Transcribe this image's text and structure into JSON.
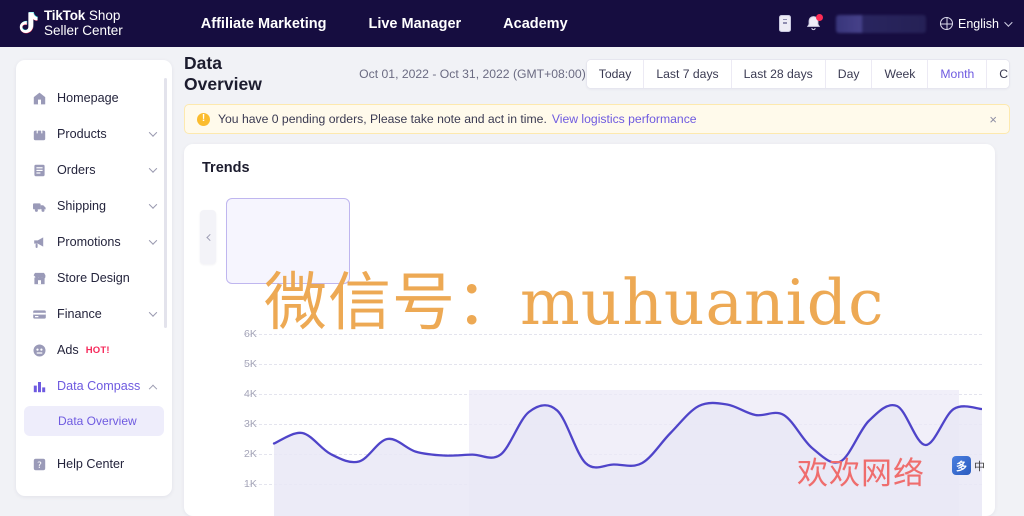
{
  "header": {
    "logo": {
      "brand": "TikTok",
      "brand_suffix": "Shop",
      "line2": "Seller Center",
      "icon": "tiktok-note-icon"
    },
    "nav": [
      {
        "label": "Affiliate Marketing"
      },
      {
        "label": "Live Manager"
      },
      {
        "label": "Academy"
      }
    ],
    "phone_icon": "mobile-phone-icon",
    "bell_icon": "notification-bell-icon",
    "language": {
      "label": "English",
      "icon": "globe-icon",
      "caret": "chevron-down-icon"
    }
  },
  "sidebar": {
    "items": [
      {
        "label": "Homepage",
        "icon": "home-icon",
        "expandable": false,
        "active": false
      },
      {
        "label": "Products",
        "icon": "bag-icon",
        "expandable": true,
        "active": false
      },
      {
        "label": "Orders",
        "icon": "receipt-icon",
        "expandable": true,
        "active": false
      },
      {
        "label": "Shipping",
        "icon": "truck-icon",
        "expandable": true,
        "active": false
      },
      {
        "label": "Promotions",
        "icon": "megaphone-icon",
        "expandable": true,
        "active": false
      },
      {
        "label": "Store Design",
        "icon": "storefront-icon",
        "expandable": false,
        "active": false
      },
      {
        "label": "Finance",
        "icon": "card-icon",
        "expandable": true,
        "active": false
      },
      {
        "label": "Ads",
        "icon": "ads-icon",
        "expandable": false,
        "active": false,
        "badge": "HOT!"
      },
      {
        "label": "Data Compass",
        "icon": "bar-chart-icon",
        "expandable": true,
        "expanded": true,
        "active": true
      }
    ],
    "sub_item": {
      "label": "Data Overview",
      "active": true
    },
    "last_item": {
      "label": "Help Center",
      "icon": "help-icon"
    },
    "accent": "#6e5ae0",
    "badge_color": "#f6285a"
  },
  "main": {
    "page_title": "Data Overview",
    "date_range": "Oct 01, 2022 - Oct 31, 2022 (GMT+08:00)",
    "range_tabs": [
      {
        "label": "Today",
        "active": false
      },
      {
        "label": "Last 7 days",
        "active": false
      },
      {
        "label": "Last 28 days",
        "active": false
      },
      {
        "label": "Day",
        "active": false
      },
      {
        "label": "Week",
        "active": false
      },
      {
        "label": "Month",
        "active": true
      },
      {
        "label": "Custom",
        "active": false
      }
    ],
    "alert": {
      "icon": "warning-icon",
      "icon_glyph": "!",
      "text": "You have 0 pending orders, Please take note and act in time.",
      "link": "View logistics performance",
      "close": "×"
    },
    "card": {
      "title": "Trends",
      "prev_button": "chevron-left-icon",
      "metric_card_selected": true
    }
  },
  "watermarks": {
    "orange": "微信号：muhuanidc",
    "red": "欢欢网络",
    "badge": "多",
    "badge2": "中"
  },
  "chart_data": {
    "type": "line",
    "title": "Trends",
    "xlabel": "",
    "ylabel": "",
    "ylim": [
      0,
      6500
    ],
    "grid": true,
    "legend": null,
    "ytick_labels": [
      "6K",
      "5K",
      "4K",
      "3K",
      "2K",
      "1K"
    ],
    "ytick_values": [
      6000,
      5000,
      4000,
      3000,
      2000,
      1000
    ],
    "series": [
      {
        "name": "Trend",
        "color": "#4f44c9",
        "fill": "#ebe9f7",
        "values": [
          2350,
          2700,
          2000,
          1750,
          2500,
          2080,
          1950,
          1980,
          1980,
          3400,
          3450,
          1700,
          1650,
          1700,
          2700,
          3600,
          3650,
          3300,
          3300,
          2200,
          1750,
          3100,
          3600,
          2300,
          3500,
          3500
        ]
      }
    ]
  }
}
